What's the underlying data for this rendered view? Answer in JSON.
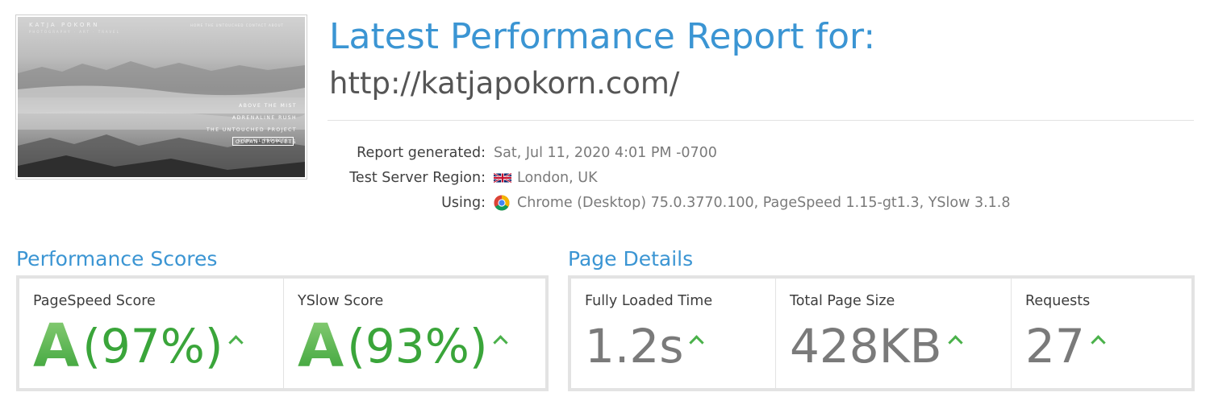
{
  "thumbnail": {
    "logo": "KATJA POKORN",
    "subtitle": "PHOTOGRAPHY · ART · TRAVEL",
    "nav_links": "HOME   THE UNTOUCHED   CONTACT   ABOUT",
    "menu": [
      "ABOVE THE MIST",
      "ADRENALINE RUSH",
      "THE UNTOUCHED PROJECT",
      "OCEAN DROPLETS"
    ],
    "button": "VIEW ALL PROJECTS"
  },
  "header": {
    "title": "Latest Performance Report for:",
    "url": "http://katjapokorn.com/"
  },
  "meta": {
    "report_generated_label": "Report generated:",
    "report_generated_value": "Sat, Jul 11, 2020 4:01 PM -0700",
    "region_label": "Test Server Region:",
    "region_value": "London, UK",
    "region_icon": "uk-flag-icon",
    "using_label": "Using:",
    "using_value": "Chrome (Desktop) 75.0.3770.100, PageSpeed 1.15-gt1.3, YSlow 3.1.8",
    "using_icon": "chrome-icon"
  },
  "performance": {
    "title": "Performance Scores",
    "pagespeed_label": "PageSpeed Score",
    "pagespeed_grade": "A",
    "pagespeed_pct": "(97%)",
    "yslow_label": "YSlow Score",
    "yslow_grade": "A",
    "yslow_pct": "(93%)"
  },
  "details": {
    "title": "Page Details",
    "loaded_label": "Fully Loaded Time",
    "loaded_value": "1.2s",
    "size_label": "Total Page Size",
    "size_value": "428KB",
    "requests_label": "Requests",
    "requests_value": "27"
  },
  "colors": {
    "accent_blue": "#3b95d3",
    "grade_green": "#4ab14a",
    "text_gray": "#7a7a7a"
  }
}
